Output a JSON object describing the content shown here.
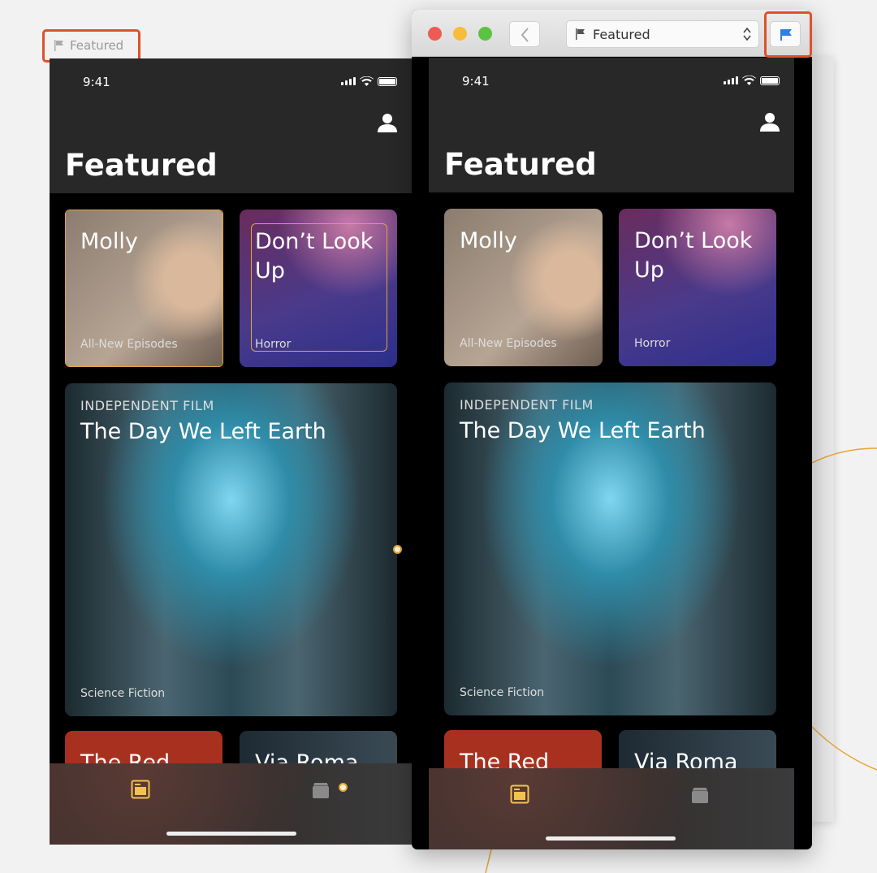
{
  "canvas_label": {
    "icon": "flag-icon",
    "text": "Featured"
  },
  "window": {
    "back_icon": "chevron-left-icon",
    "screen_select": {
      "icon": "flag-icon",
      "value": "Featured"
    },
    "flag_button_icon": "flag-icon",
    "flag_color": "#2f7fe0"
  },
  "phone": {
    "status": {
      "time": "9:41"
    },
    "header": {
      "title": "Featured",
      "profile_icon": "person-icon"
    },
    "cards": [
      {
        "title": "Molly",
        "subtitle": "All-New Episodes"
      },
      {
        "title": "Don’t Look Up",
        "subtitle": "Horror"
      },
      {
        "kicker": "INDEPENDENT FILM",
        "title": "The Day We Left Earth",
        "subtitle": "Science Fiction"
      },
      {
        "title": "The Red"
      },
      {
        "title": "Via Roma"
      }
    ],
    "tabs": [
      {
        "icon": "featured-tab-icon",
        "active": true,
        "color": "#f2c14e"
      },
      {
        "icon": "library-tab-icon",
        "active": false,
        "color": "#8a8a8a"
      }
    ]
  },
  "colors": {
    "accent": "#e6a53a",
    "highlight": "#e0502a"
  }
}
